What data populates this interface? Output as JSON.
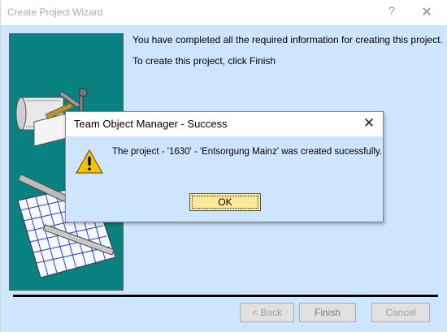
{
  "wizard": {
    "title": "Create Project Wizard",
    "help_label": "?",
    "close_label": "✕",
    "message_line1": "You have completed all the required information for creating this project.",
    "message_line2": "To create this project, click Finish",
    "buttons": {
      "back": "< Back",
      "finish": "Finish",
      "cancel": "Cancel"
    }
  },
  "dialog": {
    "title": "Team Object Manager - Success",
    "close_label": "✕",
    "icon": "warning-icon",
    "message": "The project - '1630' - 'Entsorgung Mainz'  was created sucessfully.",
    "ok_label": "OK"
  },
  "colors": {
    "panel_bg": "#cde5ff",
    "side_panel": "#0b8282",
    "ok_button": "#ffe79a"
  }
}
